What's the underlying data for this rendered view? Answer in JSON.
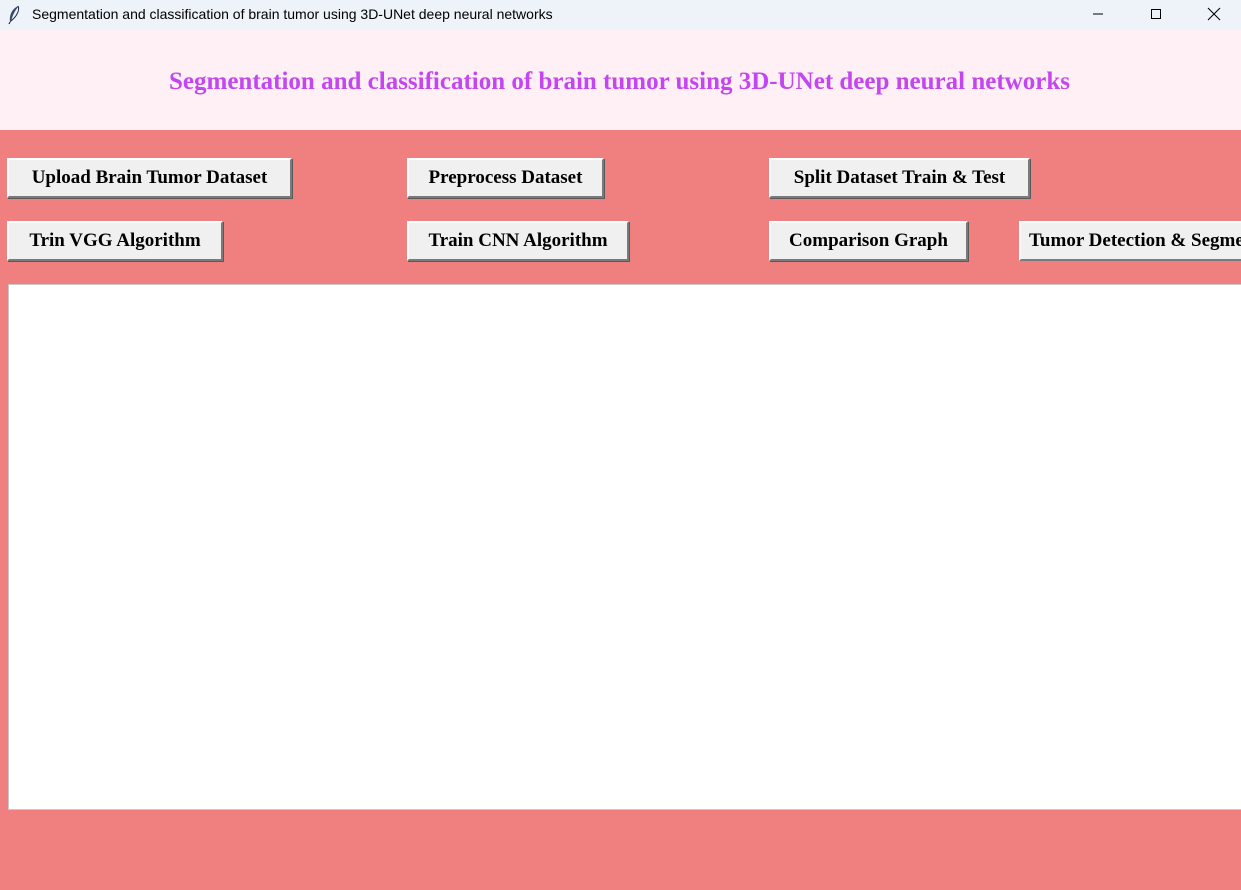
{
  "window": {
    "title": "Segmentation and classification of brain tumor using 3D-UNet deep neural networks",
    "icon": "feather-icon",
    "controls": [
      "minimize-icon",
      "maximize-icon",
      "close-icon"
    ]
  },
  "header": {
    "title": "Segmentation and classification of brain tumor using 3D-UNet deep neural networks",
    "title_color": "#c446f0",
    "background": "#fff0f5"
  },
  "buttons": {
    "upload": "Upload Brain Tumor Dataset",
    "preprocess": "Preprocess Dataset",
    "split": "Split Dataset Train & Test",
    "vgg": "Trin VGG Algorithm",
    "cnn": "Train CNN Algorithm",
    "graph": "Comparison Graph",
    "detect": "Tumor Detection & Segmentation"
  },
  "output": {
    "text": ""
  },
  "colors": {
    "background": "#f08080",
    "button_face": "#f0f0f0",
    "text_area": "#ffffff"
  }
}
